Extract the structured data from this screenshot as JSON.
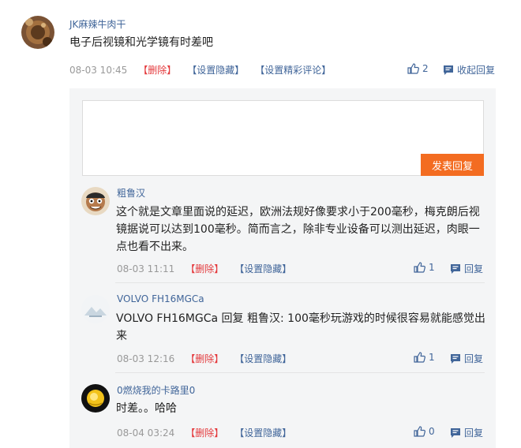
{
  "main_comment": {
    "username": "JK麻辣牛肉干",
    "text": "电子后视镜和光学镜有时差吧",
    "time": "08-03 10:45",
    "delete": "【删除】",
    "hide": "【设置隐藏】",
    "feature": "【设置精彩评论】",
    "likes": "2",
    "collapse": "收起回复"
  },
  "reply_button": "发表回复",
  "replies": [
    {
      "username": "粗鲁汉",
      "text": "这个就是文章里面说的延迟，欧洲法规好像要求小于200毫秒，梅克朗后视镜据说可以达到100毫秒。简而言之，除非专业设备可以测出延迟，肉眼一点也看不出来。",
      "time": "08-03 11:11",
      "delete": "【删除】",
      "hide": "【设置隐藏】",
      "likes": "1",
      "reply": "回复"
    },
    {
      "username": "VOLVO FH16MGCa",
      "text": "VOLVO FH16MGCa 回复 粗鲁汉: 100毫秒玩游戏的时候很容易就能感觉出来",
      "time": "08-03 12:16",
      "delete": "【删除】",
      "hide": "【设置隐藏】",
      "likes": "1",
      "reply": "回复"
    },
    {
      "username": "0燃烧我的卡路里0",
      "text": "时差。。哈哈",
      "time": "08-04 03:24",
      "delete": "【删除】",
      "hide": "【设置隐藏】",
      "likes": "0",
      "reply": "回复"
    }
  ],
  "colors": {
    "accent": "#f36c21",
    "link": "#406599",
    "delete": "#e4393c"
  }
}
